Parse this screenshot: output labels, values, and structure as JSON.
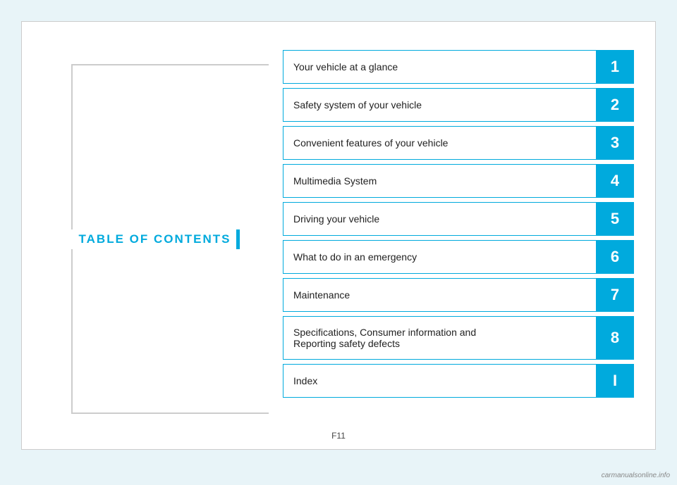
{
  "page": {
    "background_color": "#e8f4f8",
    "page_number": "F11",
    "watermark": "carmanualsonline.info"
  },
  "toc": {
    "title": "TABLE OF CONTENTS",
    "items": [
      {
        "id": 1,
        "label": "Your vehicle at a glance",
        "number": "1",
        "tall": false
      },
      {
        "id": 2,
        "label": "Safety system of your vehicle",
        "number": "2",
        "tall": false
      },
      {
        "id": 3,
        "label": "Convenient features of your vehicle",
        "number": "3",
        "tall": false
      },
      {
        "id": 4,
        "label": "Multimedia System",
        "number": "4",
        "tall": false
      },
      {
        "id": 5,
        "label": "Driving your vehicle",
        "number": "5",
        "tall": false
      },
      {
        "id": 6,
        "label": "What to do in an emergency",
        "number": "6",
        "tall": false
      },
      {
        "id": 7,
        "label": "Maintenance",
        "number": "7",
        "tall": false
      },
      {
        "id": 8,
        "label1": "Specifications, Consumer information and",
        "label2": "Reporting safety defects",
        "number": "8",
        "tall": true
      },
      {
        "id": 9,
        "label": "Index",
        "number": "I",
        "tall": false
      }
    ]
  }
}
